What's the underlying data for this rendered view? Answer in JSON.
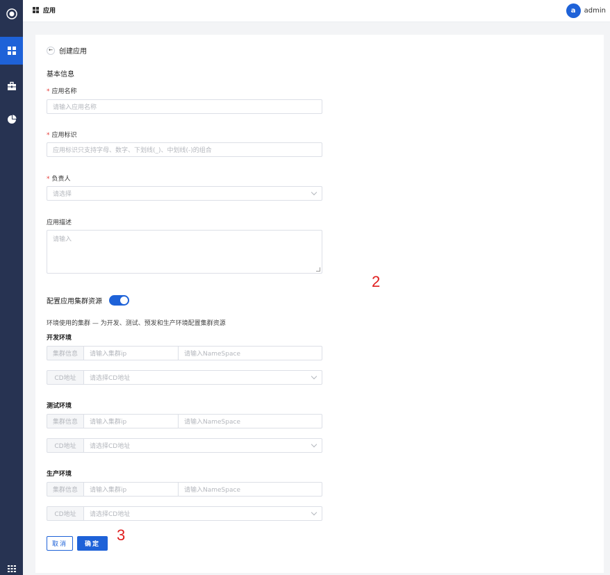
{
  "topbar": {
    "breadcrumb_label": "应用",
    "user_initial": "a",
    "username": "admin"
  },
  "page": {
    "back_title": "创建应用",
    "section_title": "基本信息"
  },
  "form": {
    "app_name": {
      "label": "应用名称",
      "placeholder": "请输入应用名称"
    },
    "app_id": {
      "label": "应用标识",
      "placeholder": "应用标识只支持字母、数字、下划线(_)、中划线(-)的组合"
    },
    "owner": {
      "label": "负责人",
      "placeholder": "请选择"
    },
    "description": {
      "label": "应用描述",
      "placeholder": "请输入"
    },
    "cluster_toggle": {
      "label": "配置应用集群资源",
      "enabled": true
    },
    "hint": "环境使用的集群 — 为开发、测试、预发和生产环境配置集群资源",
    "environments": [
      {
        "title": "开发环境",
        "cluster_addon": "集群信息",
        "ip_placeholder": "请输入集群ip",
        "ns_placeholder": "请输入NameSpace",
        "cd_addon": "CD地址",
        "cd_placeholder": "请选择CD地址"
      },
      {
        "title": "测试环境",
        "cluster_addon": "集群信息",
        "ip_placeholder": "请输入集群ip",
        "ns_placeholder": "请输入NameSpace",
        "cd_addon": "CD地址",
        "cd_placeholder": "请选择CD地址"
      },
      {
        "title": "生产环境",
        "cluster_addon": "集群信息",
        "ip_placeholder": "请输入集群ip",
        "ns_placeholder": "请输入NameSpace",
        "cd_addon": "CD地址",
        "cd_placeholder": "请选择CD地址"
      }
    ],
    "cancel_label": "取消",
    "confirm_label": "确定"
  },
  "annotations": {
    "marker_2": "2",
    "marker_3": "3"
  },
  "colors": {
    "primary": "#1e62d8",
    "sidebar": "#273352",
    "required": "#e53935",
    "annotation": "#e01e1e"
  }
}
